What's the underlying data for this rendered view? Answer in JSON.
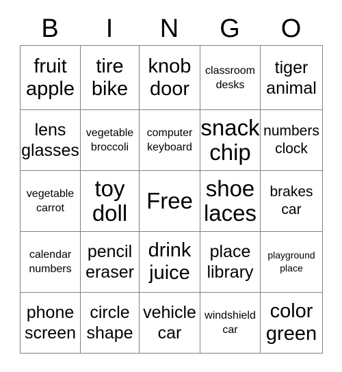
{
  "card": {
    "title_letters": [
      "B",
      "I",
      "N",
      "G",
      "O"
    ],
    "rows": [
      [
        {
          "top": "fruit",
          "bottom": "apple",
          "size": "lg"
        },
        {
          "top": "tire",
          "bottom": "bike",
          "size": "lg"
        },
        {
          "top": "knob",
          "bottom": "door",
          "size": "lg"
        },
        {
          "top": "classroom",
          "bottom": "desks",
          "size": "xs"
        },
        {
          "top": "tiger",
          "bottom": "animal",
          "size": "md"
        }
      ],
      [
        {
          "top": "lens",
          "bottom": "glasses",
          "size": "md"
        },
        {
          "top": "vegetable",
          "bottom": "broccoli",
          "size": "xs"
        },
        {
          "top": "computer",
          "bottom": "keyboard",
          "size": "xs"
        },
        {
          "top": "snack",
          "bottom": "chip",
          "size": "xl"
        },
        {
          "top": "numbers",
          "bottom": "clock",
          "size": "sm"
        }
      ],
      [
        {
          "top": "vegetable",
          "bottom": "carrot",
          "size": "xs"
        },
        {
          "top": "toy",
          "bottom": "doll",
          "size": "xl"
        },
        {
          "top": "Free",
          "bottom": "",
          "size": "free"
        },
        {
          "top": "shoe",
          "bottom": "laces",
          "size": "xl"
        },
        {
          "top": "brakes",
          "bottom": "car",
          "size": "sm"
        }
      ],
      [
        {
          "top": "calendar",
          "bottom": "numbers",
          "size": "xs"
        },
        {
          "top": "pencil",
          "bottom": "eraser",
          "size": "md"
        },
        {
          "top": "drink",
          "bottom": "juice",
          "size": "lg"
        },
        {
          "top": "place",
          "bottom": "library",
          "size": "md"
        },
        {
          "top": "playground",
          "bottom": "place",
          "size": "xxs"
        }
      ],
      [
        {
          "top": "phone",
          "bottom": "screen",
          "size": "md"
        },
        {
          "top": "circle",
          "bottom": "shape",
          "size": "md"
        },
        {
          "top": "vehicle",
          "bottom": "car",
          "size": "md"
        },
        {
          "top": "windshield",
          "bottom": "car",
          "size": "xs"
        },
        {
          "top": "color",
          "bottom": "green",
          "size": "lg"
        }
      ]
    ]
  },
  "colors": {
    "grid_border": "#808080",
    "text": "#000000",
    "background": "#ffffff"
  }
}
